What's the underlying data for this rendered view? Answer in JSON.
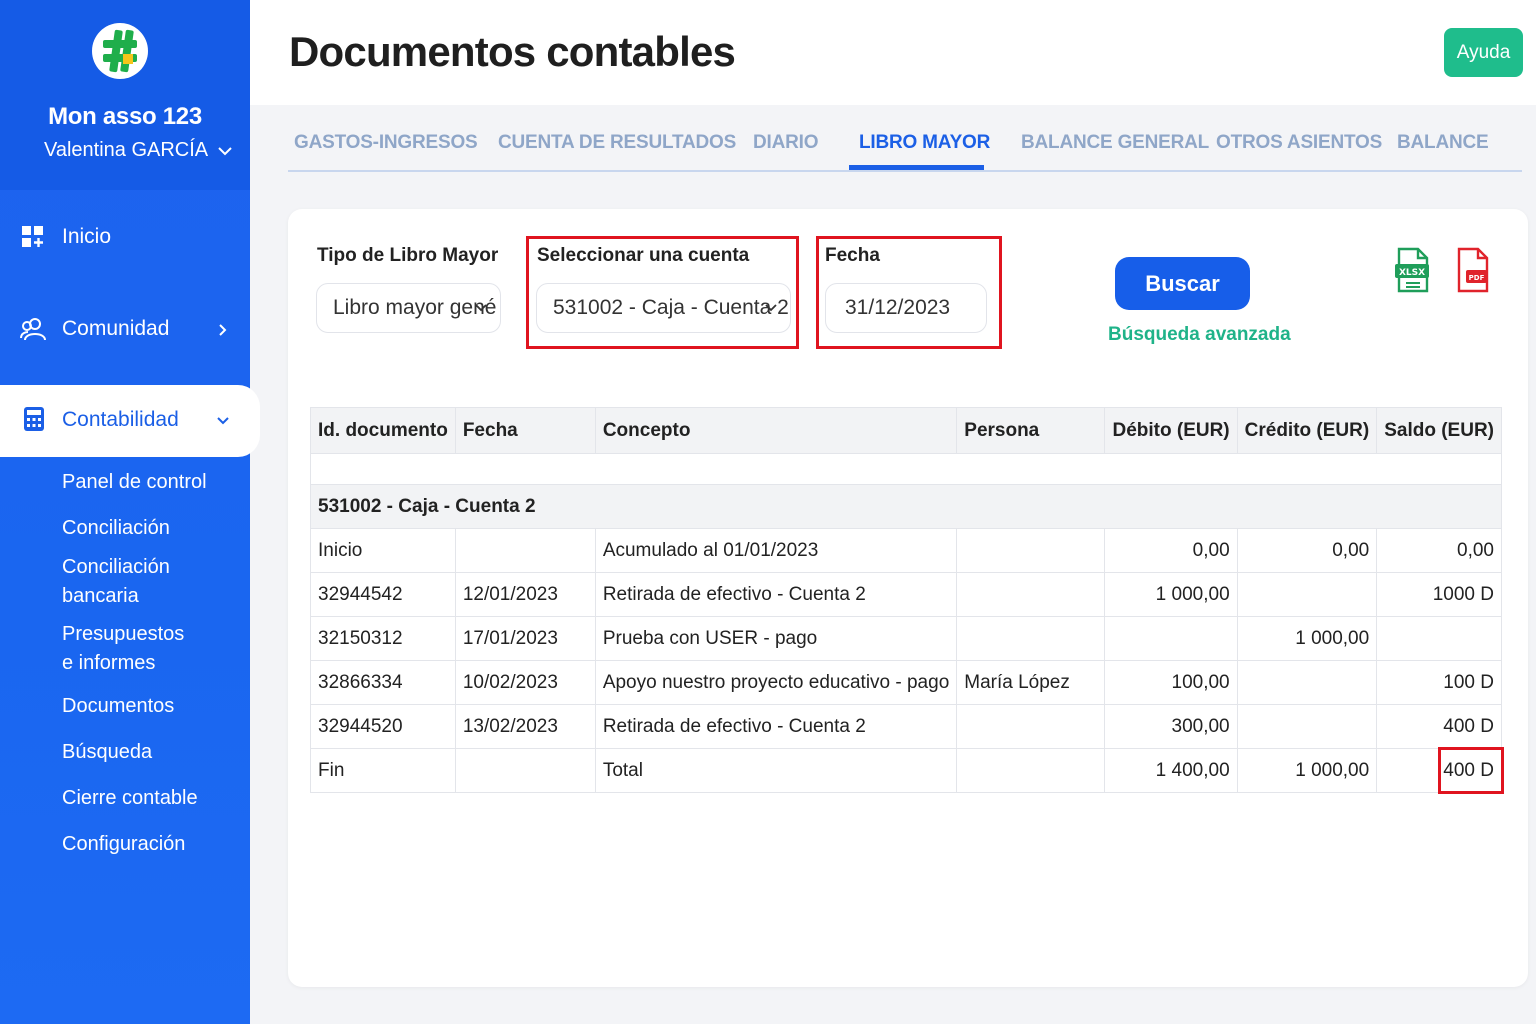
{
  "sidebar": {
    "org_name": "Mon asso 123",
    "user_name": "Valentina GARCÍA",
    "nav": [
      {
        "label": "Inicio",
        "icon": "dashboard-icon"
      },
      {
        "label": "Comunidad",
        "icon": "users-icon"
      },
      {
        "label": "Contabilidad",
        "icon": "calculator-icon"
      }
    ],
    "sub_items": [
      "Panel de control",
      "Conciliación",
      "Conciliación bancaria",
      "Presupuestos e informes",
      "Documentos",
      "Búsqueda",
      "Cierre contable",
      "Configuración"
    ],
    "colors": {
      "bg": "#1e62ee",
      "accent": "#1b5fe6"
    }
  },
  "header": {
    "title": "Documentos contables",
    "help_label": "Ayuda",
    "help_color": "#1fbd8c"
  },
  "tabs": [
    {
      "label": "GASTOS-INGRESOS",
      "active": false
    },
    {
      "label": "CUENTA DE RESULTADOS",
      "active": false
    },
    {
      "label": "DIARIO",
      "active": false
    },
    {
      "label": "LIBRO MAYOR",
      "active": true
    },
    {
      "label": "BALANCE GENERAL",
      "active": false
    },
    {
      "label": "OTROS ASIENTOS",
      "active": false
    },
    {
      "label": "BALANCE",
      "active": false
    }
  ],
  "filters": {
    "type_label": "Tipo de Libro Mayor",
    "type_value": "Libro mayor gené",
    "account_label": "Seleccionar una cuenta",
    "account_value": "531002 - Caja - Cuenta 2",
    "date_label": "Fecha",
    "date_value": "31/12/2023",
    "search_label": "Buscar",
    "advanced_label": "Búsqueda avanzada"
  },
  "exports": {
    "xlsx_label": "XLSX",
    "pdf_label": "PDF"
  },
  "table": {
    "columns": [
      "Id. documento",
      "Fecha",
      "Concepto",
      "Persona",
      "Débito (EUR)",
      "Crédito (EUR)",
      "Saldo (EUR)"
    ],
    "group_label": "531002 - Caja - Cuenta 2",
    "rows": [
      [
        "Inicio",
        "",
        "Acumulado al 01/01/2023",
        "",
        "0,00",
        "0,00",
        "0,00"
      ],
      [
        "32944542",
        "12/01/2023",
        "Retirada de efectivo - Cuenta 2",
        "",
        "1 000,00",
        "",
        "1000 D"
      ],
      [
        "32150312",
        "17/01/2023",
        "Prueba con USER - pago",
        "",
        "",
        "1 000,00",
        ""
      ],
      [
        "32866334",
        "10/02/2023",
        "Apoyo nuestro proyecto educativo - pago",
        "María López",
        "100,00",
        "",
        "100 D"
      ],
      [
        "32944520",
        "13/02/2023",
        "Retirada de efectivo - Cuenta 2",
        "",
        "300,00",
        "",
        "400 D"
      ],
      [
        "Fin",
        "",
        "Total",
        "",
        "1 400,00",
        "1 000,00",
        "400 D"
      ]
    ]
  }
}
